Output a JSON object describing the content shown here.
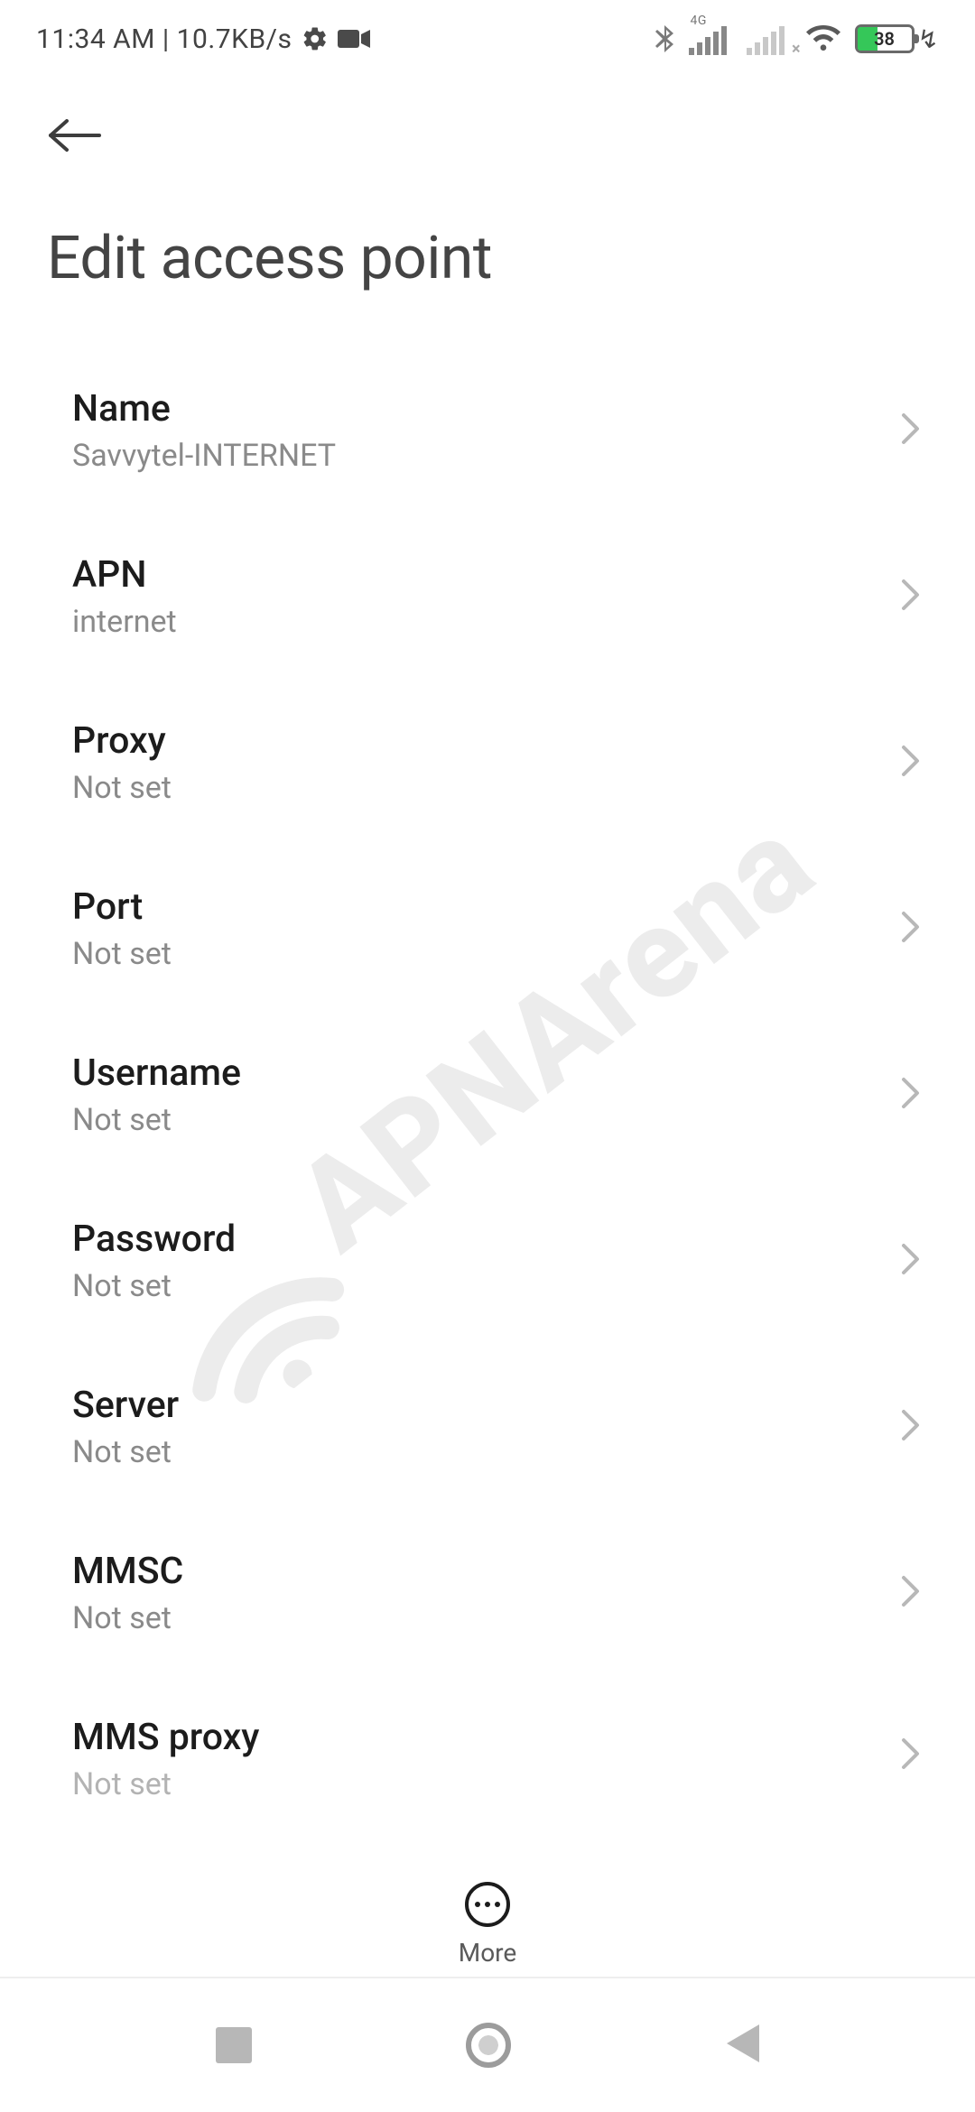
{
  "status_bar": {
    "time": "11:34 AM",
    "separator": "|",
    "net_speed": "10.7KB/s",
    "network_label": "4G",
    "battery_pct": 38
  },
  "header": {
    "title": "Edit access point"
  },
  "settings": [
    {
      "label": "Name",
      "value": "Savvytel-INTERNET"
    },
    {
      "label": "APN",
      "value": "internet"
    },
    {
      "label": "Proxy",
      "value": "Not set"
    },
    {
      "label": "Port",
      "value": "Not set"
    },
    {
      "label": "Username",
      "value": "Not set"
    },
    {
      "label": "Password",
      "value": "Not set"
    },
    {
      "label": "Server",
      "value": "Not set"
    },
    {
      "label": "MMSC",
      "value": "Not set"
    },
    {
      "label": "MMS proxy",
      "value": "Not set"
    }
  ],
  "toolbar": {
    "more_label": "More"
  },
  "watermark": {
    "text": "APNArena"
  }
}
